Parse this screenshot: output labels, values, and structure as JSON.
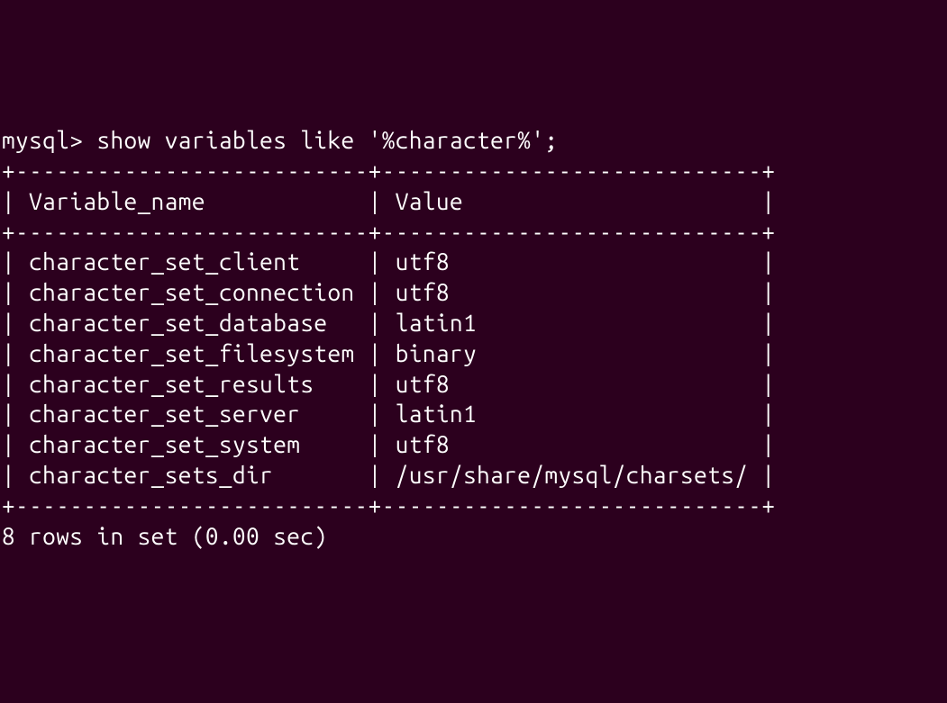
{
  "prompt": "mysql>",
  "command": "show variables like '%character%';",
  "table": {
    "border_top": "+--------------------------+----------------------------+",
    "border_mid": "+--------------------------+----------------------------+",
    "border_bottom": "+--------------------------+----------------------------+",
    "header": {
      "col1": "Variable_name",
      "col2": "Value"
    },
    "rows": [
      {
        "col1": "character_set_client",
        "col2": "utf8"
      },
      {
        "col1": "character_set_connection",
        "col2": "utf8"
      },
      {
        "col1": "character_set_database",
        "col2": "latin1"
      },
      {
        "col1": "character_set_filesystem",
        "col2": "binary"
      },
      {
        "col1": "character_set_results",
        "col2": "utf8"
      },
      {
        "col1": "character_set_server",
        "col2": "latin1"
      },
      {
        "col1": "character_set_system",
        "col2": "utf8"
      },
      {
        "col1": "character_sets_dir",
        "col2": "/usr/share/mysql/charsets/"
      }
    ]
  },
  "footer": "8 rows in set (0.00 sec)",
  "col1_width": 24,
  "col2_width": 26
}
